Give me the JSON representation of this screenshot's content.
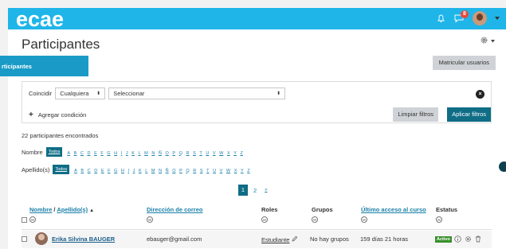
{
  "app": {
    "logo": "ecae",
    "notif_badge": "8"
  },
  "page": {
    "title": "Participantes",
    "tab_label": "rticipantes",
    "enrol_button": "Matricular usuarios"
  },
  "filters": {
    "match_label": "Coincidir",
    "match_value": "Cualquiera",
    "select_value": "Seleccionar",
    "add_condition": "Agregar condición",
    "clear_button": "Limpiar filtros",
    "apply_button": "Aplicar filtros"
  },
  "results": {
    "count_text": "22 participantes encontrados"
  },
  "initials": {
    "first_name_label": "Nombre",
    "last_name_label": "Apellido(s)",
    "all_label": "Todos",
    "letters": [
      "A",
      "B",
      "C",
      "D",
      "E",
      "F",
      "G",
      "H",
      "I",
      "J",
      "K",
      "L",
      "M",
      "N",
      "Ñ",
      "O",
      "P",
      "Q",
      "R",
      "S",
      "T",
      "U",
      "V",
      "W",
      "X",
      "Y",
      "Z"
    ]
  },
  "pagination": {
    "current": "1",
    "next_page": "2",
    "next_arrow": "»"
  },
  "table": {
    "headers": {
      "name": "Nombre",
      "separator": " / ",
      "surname": "Apellido(s)",
      "sort_indicator": "▲",
      "email": "Dirección de correo",
      "roles": "Roles",
      "groups": "Grupos",
      "last_access": "Último acceso al curso",
      "status": "Estatus"
    },
    "rows": [
      {
        "name": "Erika Silvina BAUGER",
        "email": "ebauger@gmail.com",
        "role": "Estudiante",
        "groups": "No hay grupos",
        "last_access": "159 días 21 horas",
        "status": "Activo"
      }
    ]
  },
  "colors": {
    "navbar": "#1fb5e9",
    "primary": "#0f6d86",
    "tab": "#1a9bc7",
    "status_active": "#3a8f2d",
    "badge": "#e8483b"
  }
}
